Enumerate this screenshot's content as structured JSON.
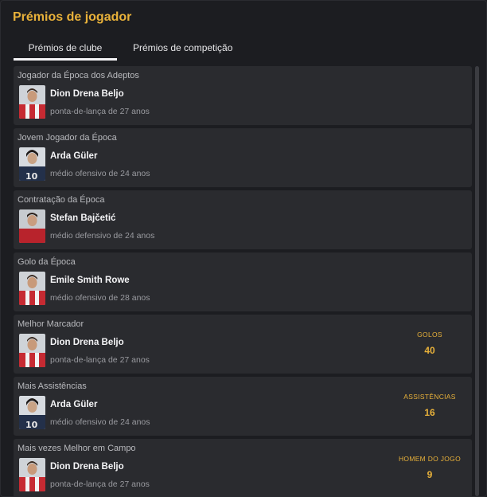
{
  "panel": {
    "title": "Prémios de jogador"
  },
  "tabs": [
    {
      "label": "Prémios de clube",
      "active": true
    },
    {
      "label": "Prémios de competição",
      "active": false
    }
  ],
  "awards": [
    {
      "title": "Jogador da Época dos Adeptos",
      "player": "Dion Drena Beljo",
      "desc": "ponta-de-lança de 27 anos",
      "kit": "red-white"
    },
    {
      "title": "Jovem Jogador da Época",
      "player": "Arda Güler",
      "desc": "médio ofensivo de 24 anos",
      "kit": "navy"
    },
    {
      "title": "Contratação da Época",
      "player": "Stefan Bajčetić",
      "desc": "médio defensivo de 24 anos",
      "kit": "red"
    },
    {
      "title": "Golo da Época",
      "player": "Emile Smith Rowe",
      "desc": "médio ofensivo de 28 anos",
      "kit": "red-white"
    },
    {
      "title": "Melhor Marcador",
      "player": "Dion Drena Beljo",
      "desc": "ponta-de-lança de 27 anos",
      "kit": "red-white",
      "stat_label": "GOLOS",
      "stat_value": "40"
    },
    {
      "title": "Mais Assistências",
      "player": "Arda Güler",
      "desc": "médio ofensivo de 24 anos",
      "kit": "navy",
      "stat_label": "ASSISTÊNCIAS",
      "stat_value": "16"
    },
    {
      "title": "Mais vezes Melhor em Campo",
      "player": "Dion Drena Beljo",
      "desc": "ponta-de-lança de 27 anos",
      "kit": "red-white",
      "stat_label": "HOMEM DO JOGO",
      "stat_value": "9"
    }
  ],
  "colors": {
    "accent": "#e8b13a",
    "card": "#2a2b2f",
    "background": "#1c1d21"
  }
}
